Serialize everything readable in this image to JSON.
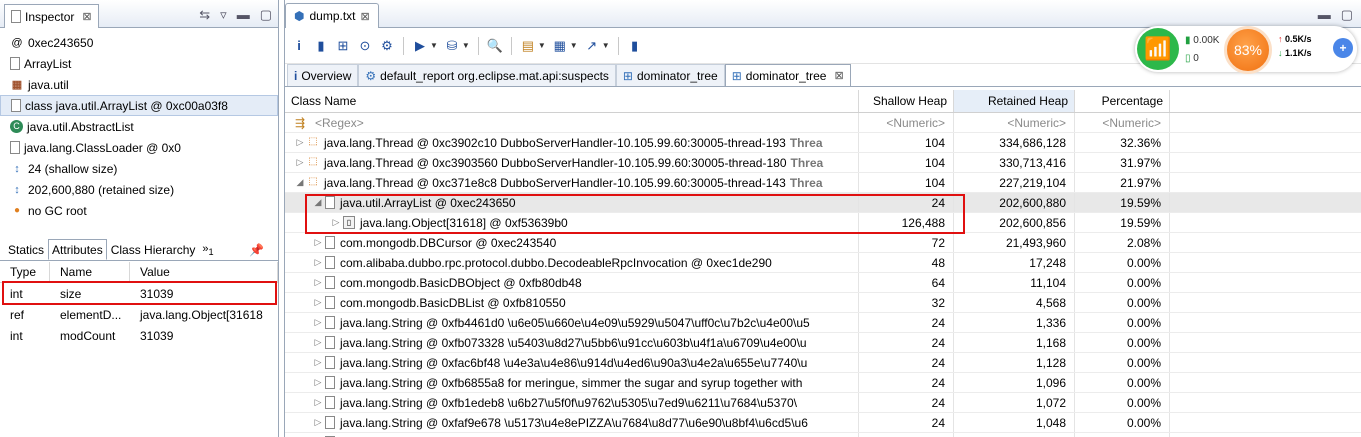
{
  "inspector": {
    "tab_label": "Inspector",
    "close": "⊠",
    "items": [
      {
        "icon": "@",
        "text": "0xec243650"
      },
      {
        "icon": "file",
        "text": "ArrayList"
      },
      {
        "icon": "package",
        "text": "java.util"
      },
      {
        "icon": "file",
        "text": "class java.util.ArrayList @ 0xc00a03f8"
      },
      {
        "icon": "class",
        "text": "java.util.AbstractList"
      },
      {
        "icon": "file",
        "text": "java.lang.ClassLoader @ 0x0"
      },
      {
        "icon": "size",
        "text": "24 (shallow size)"
      },
      {
        "icon": "size",
        "text": "202,600,880 (retained size)"
      },
      {
        "icon": "gc",
        "text": "no GC root"
      }
    ],
    "attr_tabs": [
      "Statics",
      "Attributes",
      "Class Hierarchy"
    ],
    "attr_more": "»",
    "attr_more_count": "1",
    "columns": [
      "Type",
      "Name",
      "Value"
    ],
    "rows": [
      {
        "type": "int",
        "name": "size",
        "value": "31039"
      },
      {
        "type": "ref",
        "name": "elementD...",
        "value": "java.lang.Object[31618"
      },
      {
        "type": "int",
        "name": "modCount",
        "value": "31039"
      }
    ]
  },
  "editor": {
    "file_tab": "dump.txt",
    "close": "⊠",
    "sub_tabs": [
      {
        "label": "Overview",
        "icon": "info"
      },
      {
        "label": "default_report  org.eclipse.mat.api:suspects",
        "icon": "report"
      },
      {
        "label": "dominator_tree",
        "icon": "tree"
      },
      {
        "label": "dominator_tree",
        "icon": "tree",
        "active": true
      }
    ],
    "columns": [
      "Class Name",
      "Shallow Heap",
      "Retained Heap",
      "Percentage"
    ],
    "regex_row": {
      "name": "<Regex>",
      "shallow": "<Numeric>",
      "retained": "<Numeric>",
      "pct": "<Numeric>"
    },
    "rows": [
      {
        "indent": 0,
        "tw": "▷",
        "icon": "thread",
        "name": "java.lang.Thread @ 0xc3902c10  DubboServerHandler-10.105.99.60:30005-thread-193",
        "extra": "Threa",
        "shallow": "104",
        "retained": "334,686,128",
        "pct": "32.36%"
      },
      {
        "indent": 0,
        "tw": "▷",
        "icon": "thread",
        "name": "java.lang.Thread @ 0xc3903560  DubboServerHandler-10.105.99.60:30005-thread-180",
        "extra": "Threa",
        "shallow": "104",
        "retained": "330,713,416",
        "pct": "31.97%"
      },
      {
        "indent": 0,
        "tw": "◢",
        "icon": "thread",
        "name": "java.lang.Thread @ 0xc371e8c8  DubboServerHandler-10.105.99.60:30005-thread-143",
        "extra": "Threa",
        "shallow": "104",
        "retained": "227,219,104",
        "pct": "21.97%"
      },
      {
        "indent": 1,
        "tw": "◢",
        "icon": "file",
        "name": "java.util.ArrayList @ 0xec243650",
        "extra": "",
        "shallow": "24",
        "retained": "202,600,880",
        "pct": "19.59%",
        "selected": true
      },
      {
        "indent": 2,
        "tw": "▷",
        "icon": "array",
        "name": "java.lang.Object[31618] @ 0xf53639b0",
        "extra": "",
        "shallow": "126,488",
        "retained": "202,600,856",
        "pct": "19.59%"
      },
      {
        "indent": 1,
        "tw": "▷",
        "icon": "file",
        "name": "com.mongodb.DBCursor @ 0xec243540",
        "extra": "",
        "shallow": "72",
        "retained": "21,493,960",
        "pct": "2.08%"
      },
      {
        "indent": 1,
        "tw": "▷",
        "icon": "file",
        "name": "com.alibaba.dubbo.rpc.protocol.dubbo.DecodeableRpcInvocation @ 0xec1de290",
        "extra": "",
        "shallow": "48",
        "retained": "17,248",
        "pct": "0.00%"
      },
      {
        "indent": 1,
        "tw": "▷",
        "icon": "file",
        "name": "com.mongodb.BasicDBObject @ 0xfb80db48",
        "extra": "",
        "shallow": "64",
        "retained": "11,104",
        "pct": "0.00%"
      },
      {
        "indent": 1,
        "tw": "▷",
        "icon": "file",
        "name": "com.mongodb.BasicDBList @ 0xfb810550",
        "extra": "",
        "shallow": "32",
        "retained": "4,568",
        "pct": "0.00%"
      },
      {
        "indent": 1,
        "tw": "▷",
        "icon": "file",
        "name": "java.lang.String @ 0xfb4461d0  \\u6e05\\u660e\\u4e09\\u5929\\u5047\\uff0c\\u7b2c\\u4e00\\u5",
        "extra": "",
        "shallow": "24",
        "retained": "1,336",
        "pct": "0.00%"
      },
      {
        "indent": 1,
        "tw": "▷",
        "icon": "file",
        "name": "java.lang.String @ 0xfb073328  \\u5403\\u8d27\\u5bb6\\u91cc\\u603b\\u4f1a\\u6709\\u4e00\\u",
        "extra": "",
        "shallow": "24",
        "retained": "1,168",
        "pct": "0.00%"
      },
      {
        "indent": 1,
        "tw": "▷",
        "icon": "file",
        "name": "java.lang.String @ 0xfac6bf48  \\u4e3a\\u4e86\\u914d\\u4ed6\\u90a3\\u4e2a\\u655e\\u7740\\u",
        "extra": "",
        "shallow": "24",
        "retained": "1,128",
        "pct": "0.00%"
      },
      {
        "indent": 1,
        "tw": "▷",
        "icon": "file",
        "name": "java.lang.String @ 0xfb6855a8  for meringue,  simmer the sugar and syrup together with",
        "extra": "",
        "shallow": "24",
        "retained": "1,096",
        "pct": "0.00%"
      },
      {
        "indent": 1,
        "tw": "▷",
        "icon": "file",
        "name": "java.lang.String @ 0xfb1edeb8   \\u6b27\\u5f0f\\u9762\\u5305\\u7ed9\\u6211\\u7684\\u5370\\",
        "extra": "",
        "shallow": "24",
        "retained": "1,072",
        "pct": "0.00%"
      },
      {
        "indent": 1,
        "tw": "▷",
        "icon": "file",
        "name": "java.lang.String @ 0xfaf9e678  \\u5173\\u4e8ePIZZA\\u7684\\u8d77\\u6e90\\u8bf4\\u6cd5\\u6",
        "extra": "",
        "shallow": "24",
        "retained": "1,048",
        "pct": "0.00%"
      },
      {
        "indent": 1,
        "tw": "▷",
        "icon": "file",
        "name": "",
        "extra": "",
        "shallow": "",
        "retained": "",
        "pct": ""
      }
    ]
  },
  "net_widget": {
    "upload_left": "0.00K",
    "down_left": "0",
    "percent": "83%",
    "upload_rate": "0.5K/s",
    "download_rate": "1.1K/s"
  }
}
